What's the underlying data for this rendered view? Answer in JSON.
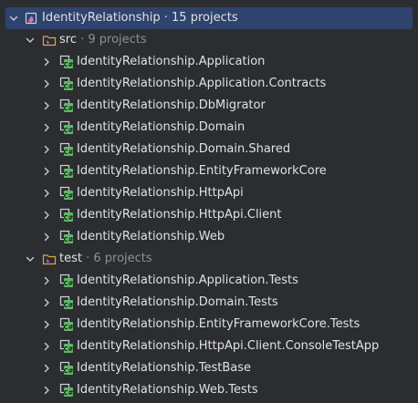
{
  "root": {
    "name": "IdentityRelationship",
    "meta": " · 15 projects",
    "icon": "solution-icon"
  },
  "folders": [
    {
      "name": "src",
      "meta": " · 9 projects",
      "icon": "folder-icon",
      "projects": [
        "IdentityRelationship.Application",
        "IdentityRelationship.Application.Contracts",
        "IdentityRelationship.DbMigrator",
        "IdentityRelationship.Domain",
        "IdentityRelationship.Domain.Shared",
        "IdentityRelationship.EntityFrameworkCore",
        "IdentityRelationship.HttpApi",
        "IdentityRelationship.HttpApi.Client",
        "IdentityRelationship.Web"
      ]
    },
    {
      "name": "test",
      "meta": " · 6 projects",
      "icon": "folder-icon",
      "projects": [
        "IdentityRelationship.Application.Tests",
        "IdentityRelationship.Domain.Tests",
        "IdentityRelationship.EntityFrameworkCore.Tests",
        "IdentityRelationship.HttpApi.Client.ConsoleTestApp",
        "IdentityRelationship.TestBase",
        "IdentityRelationship.Web.Tests"
      ]
    }
  ],
  "project_icon": "csharp-project-icon",
  "colors": {
    "background": "#2b2d30",
    "selection": "#2e436e",
    "text": "#dfe1e5",
    "muted": "#8c8f94",
    "csharp_green": "#5fb865",
    "folder_orange": "#e2a24b"
  }
}
